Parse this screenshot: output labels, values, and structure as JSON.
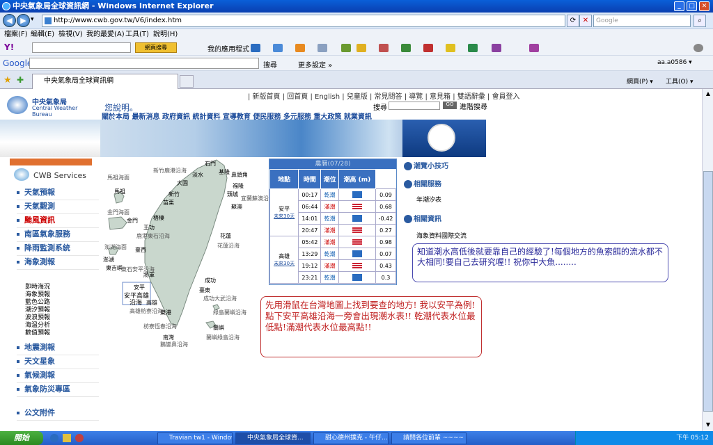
{
  "window": {
    "title": "中央氣象局全球資訊網 - Windows Internet Explorer"
  },
  "address": {
    "url": "http://www.cwb.gov.tw/V6/index.htm",
    "search_placeholder": "Google"
  },
  "menu": [
    "檔案(F)",
    "編輯(E)",
    "檢視(V)",
    "我的最愛(A)",
    "工具(T)",
    "說明(H)"
  ],
  "yahoo": {
    "search_label": "網頁搜尋",
    "apps_label": "我的應用程式"
  },
  "google": {
    "label": "Google",
    "search_label": "搜尋",
    "more_label": "更多設定 »",
    "account": "aa.a0586 ▾",
    "tools": "工具(O) ▾",
    "page": "網頁(P) ▾"
  },
  "tab": {
    "label": "中央氣象局全球資訊網"
  },
  "site": {
    "logo_cn": "中央氣象局",
    "logo_en": "Central Weather Bureau",
    "top_links": "| 新版首頁 | 回首頁 | English | 兒童版 | 常見問答 | 導覽 | 意見箱 | 雙語辭彙 | 會員登入",
    "search_label": "搜尋",
    "search_go": "GO",
    "advanced": "進階搜尋",
    "hello": "您說明。",
    "nav": "關於本局  最新消息  政府資訊  統計資料  宣導教育  便民服務  多元服務  重大政策  就業資訊",
    "services_title": "CWB Services",
    "left_menu": [
      "天氣預報",
      "天氣觀測",
      "颱風資訊",
      "南區氣象服務",
      "降雨監測系統",
      "海象測報"
    ],
    "sub_menu": [
      "即時海況",
      "海象預報",
      "藍色公路",
      "潮汐預報",
      "波浪預報",
      "海溫分析",
      "數值預報"
    ],
    "left_menu2": [
      "地震測報",
      "天文星象",
      "氣候測報",
      "氣象防災專區"
    ],
    "attach": "公文附件"
  },
  "tide": {
    "header": "農曆(07/28)",
    "columns": [
      "地點",
      "時間",
      "潮位",
      "潮高 (m)"
    ],
    "stations": [
      {
        "name": "安平",
        "link": "未來30天",
        "rows": [
          {
            "time": "00:17",
            "type": "乾潮",
            "height": "0.09",
            "flood": false
          },
          {
            "time": "06:44",
            "type": "滿潮",
            "height": "0.68",
            "flood": true
          },
          {
            "time": "14:01",
            "type": "乾潮",
            "height": "-0.42",
            "flood": false
          },
          {
            "time": "20:47",
            "type": "滿潮",
            "height": "0.27",
            "flood": true
          }
        ]
      },
      {
        "name": "高雄",
        "link": "未來30天",
        "rows": [
          {
            "time": "05:42",
            "type": "滿潮",
            "height": "0.98",
            "flood": true
          },
          {
            "time": "13:29",
            "type": "乾潮",
            "height": "0.07",
            "flood": false
          },
          {
            "time": "19:12",
            "type": "滿潮",
            "height": "0.43",
            "flood": true
          },
          {
            "time": "23:21",
            "type": "乾潮",
            "height": "0.3",
            "flood": false
          }
        ]
      }
    ]
  },
  "right_panel": {
    "tips": "潮覽小技巧",
    "services": "相關服務",
    "services_sub": "年潮汐表",
    "info": "相關資訊",
    "info_sub": "海象資料國際交流"
  },
  "map_labels": [
    "石門",
    "基隆",
    "鼻頭角",
    "淡水",
    "大園",
    "福隆",
    "蘇澳",
    "新竹",
    "苗栗",
    "頭城",
    "梧棲",
    "花蓮",
    "王功",
    "臺西",
    "將軍",
    "成功",
    "安平",
    "安平高雄",
    "沿海",
    "高雄",
    "臺東",
    "東港",
    "蘭嶼",
    "南灣",
    "馬祖",
    "金門",
    "澎湖",
    "東吉嶼",
    "馬祖海面",
    "金門海面",
    "澎湖海面",
    "新竹鹿港沿海",
    "宜蘭蘇澳沿海",
    "花蓮沿海",
    "鹿港東石沿海",
    "東石安平沿海",
    "成功大武沿海",
    "高雄枋寮沿海",
    "枋寮恆春沿海",
    "鵝鑾鼻沿海",
    "綠島蘭嶼沿海",
    "蘭嶼綠島沿海"
  ],
  "notes": {
    "note1": "知道潮水高低後就要靠自己的經驗了!每個地方的魚索餌的流水都不大相同!要自己去研究喔!! 祝你中大魚........",
    "note2": "先用滑鼠在台灣地圖上找到要查的地方! 我以安平為例!點下安平高雄沿海一旁會出現潮水表!! 乾潮代表水位最低點!滿潮代表水位最高點!!"
  },
  "taskbar": {
    "start": "開始",
    "tasks": [
      "Travian tw1 - Window...",
      "中央氣象局全球資...",
      "甜心德州撲克 - 午仔...",
      "請問各位前輩 ~~~~ -..."
    ],
    "clock": "下午 05:12"
  }
}
